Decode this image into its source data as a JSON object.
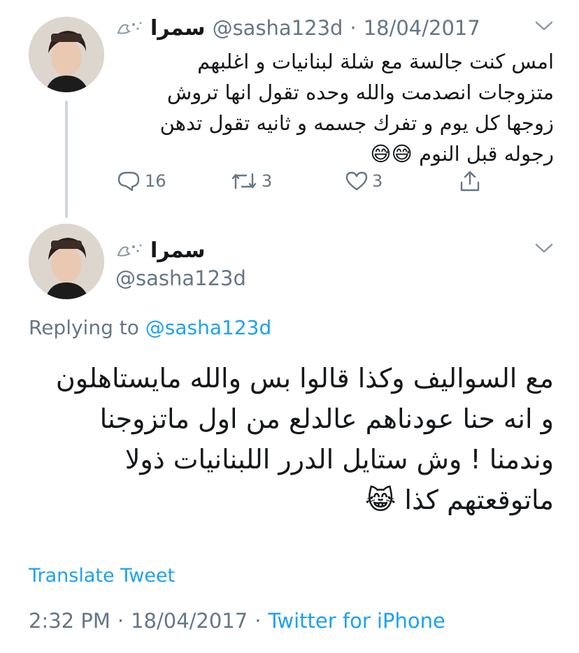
{
  "tweet1": {
    "name": "سمرا",
    "handle": "@sasha123d",
    "separator": "·",
    "date": "18/04/2017",
    "text": "امس كنت جالسة مع شلة لبنانيات و اغلبهم\nمتزوجات انصدمت والله وحده تقول انها تروش\nزوجها كل يوم و تفرك جسمه و ثانيه تقول تدهن\nرجوله قبل النوم 😅😅",
    "actions": {
      "reply_count": "16",
      "retweet_count": "3",
      "like_count": "3"
    }
  },
  "tweet2": {
    "name": "سمرا",
    "handle": "@sasha123d",
    "replying_label": "Replying to",
    "replying_handle": "@sasha123d",
    "text": "مع السواليف وكذا قالوا بس والله مايستاهلون\nو انه حنا عودناهم عالدلع من اول ماتزوجنا\nوندمنا ! وش ستايل الدرر اللبنانيات ذولا\nماتوقعتهم كذا 😹",
    "translate_label": "Translate Tweet",
    "time": "2:32 PM",
    "separator": "·",
    "date": "18/04/2017",
    "separator2": "·",
    "source": "Twitter for iPhone"
  },
  "icons": {
    "badge": "fairy-sparkle-icon",
    "chevron": "chevron-down-icon",
    "reply": "reply-icon",
    "retweet": "retweet-icon",
    "like": "heart-icon",
    "share": "share-icon"
  },
  "colors": {
    "link": "#1da1f2",
    "secondary": "#657786",
    "thread_line": "#ccd6dd"
  }
}
